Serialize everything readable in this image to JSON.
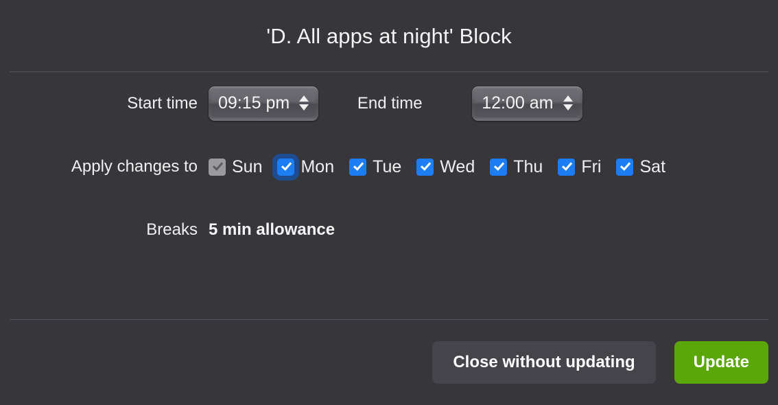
{
  "dialog": {
    "title": "'D. All apps at night' Block"
  },
  "form": {
    "start_time": {
      "label": "Start time",
      "value": "09:15 pm",
      "spinner_up_icon": "triangle-up-icon",
      "spinner_down_icon": "triangle-down-icon"
    },
    "end_time": {
      "label": "End time",
      "value": "12:00 am",
      "spinner_up_icon": "triangle-up-icon",
      "spinner_down_icon": "triangle-down-icon"
    },
    "apply_changes": {
      "label": "Apply changes to",
      "days": [
        {
          "label": "Sun",
          "checked": true,
          "disabled": true,
          "focused": false
        },
        {
          "label": "Mon",
          "checked": true,
          "disabled": false,
          "focused": true
        },
        {
          "label": "Tue",
          "checked": true,
          "disabled": false,
          "focused": false
        },
        {
          "label": "Wed",
          "checked": true,
          "disabled": false,
          "focused": false
        },
        {
          "label": "Thu",
          "checked": true,
          "disabled": false,
          "focused": false
        },
        {
          "label": "Fri",
          "checked": true,
          "disabled": false,
          "focused": false
        },
        {
          "label": "Sat",
          "checked": true,
          "disabled": false,
          "focused": false
        }
      ]
    },
    "breaks": {
      "label": "Breaks",
      "value": "5 min allowance"
    }
  },
  "footer": {
    "close_label": "Close without updating",
    "update_label": "Update"
  },
  "colors": {
    "background": "#36363b",
    "divider": "#52525a",
    "checkbox_checked": "#1d7ef3",
    "checkbox_disabled": "#9b9b9e",
    "checkbox_focus_ring": "#1d4c91",
    "button_secondary": "#44444a",
    "button_primary": "#5ba608",
    "text": "#f0f0f0"
  }
}
